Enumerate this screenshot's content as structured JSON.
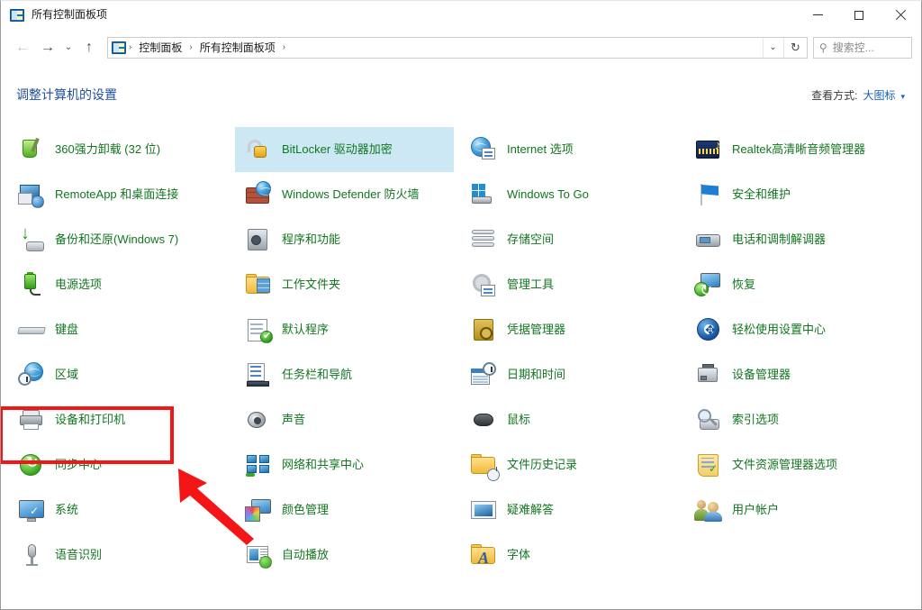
{
  "window": {
    "title": "所有控制面板项",
    "title_icon": "control-panel-icon",
    "minimize_label": "—",
    "maximize_label": "□",
    "close_label": "✕"
  },
  "navbar": {
    "back_label": "←",
    "forward_label": "→",
    "recent_label": "⌄",
    "up_label": "↑",
    "breadcrumb": [
      "控制面板",
      "所有控制面板项"
    ],
    "separator": "›",
    "dropdown_label": "⌄",
    "refresh_label": "↻"
  },
  "search": {
    "icon": "search-icon",
    "text": "搜索控..."
  },
  "header": {
    "heading": "调整计算机的设置",
    "viewby_label": "查看方式:",
    "viewby_value": "大图标",
    "viewby_caret": "▾"
  },
  "columns": [
    {
      "items": [
        {
          "label": "360强力卸载 (32 位)",
          "icon": "uninstaller-icon",
          "hover": false
        },
        {
          "label": "RemoteApp 和桌面连接",
          "icon": "remoteapp-icon",
          "hover": false
        },
        {
          "label": "备份和还原(Windows 7)",
          "icon": "backup-restore-icon",
          "hover": false
        },
        {
          "label": "电源选项",
          "icon": "power-options-icon",
          "hover": false
        },
        {
          "label": "键盘",
          "icon": "keyboard-icon",
          "hover": false
        },
        {
          "label": "区域",
          "icon": "region-icon",
          "hover": false
        },
        {
          "label": "设备和打印机",
          "icon": "devices-printers-icon",
          "hover": false
        },
        {
          "label": "同步中心",
          "icon": "sync-center-icon",
          "hover": false
        },
        {
          "label": "系统",
          "icon": "system-icon",
          "hover": false
        },
        {
          "label": "语音识别",
          "icon": "speech-recognition-icon",
          "hover": false
        }
      ]
    },
    {
      "items": [
        {
          "label": "BitLocker 驱动器加密",
          "icon": "bitlocker-icon",
          "hover": true
        },
        {
          "label": "Windows Defender 防火墙",
          "icon": "firewall-icon",
          "hover": false
        },
        {
          "label": "程序和功能",
          "icon": "programs-features-icon",
          "hover": false
        },
        {
          "label": "工作文件夹",
          "icon": "work-folders-icon",
          "hover": false
        },
        {
          "label": "默认程序",
          "icon": "default-programs-icon",
          "hover": false
        },
        {
          "label": "任务栏和导航",
          "icon": "taskbar-navigation-icon",
          "hover": false
        },
        {
          "label": "声音",
          "icon": "sound-icon",
          "hover": false
        },
        {
          "label": "网络和共享中心",
          "icon": "network-sharing-icon",
          "hover": false
        },
        {
          "label": "颜色管理",
          "icon": "color-management-icon",
          "hover": false
        },
        {
          "label": "自动播放",
          "icon": "autoplay-icon",
          "hover": false
        }
      ]
    },
    {
      "items": [
        {
          "label": "Internet 选项",
          "icon": "internet-options-icon",
          "hover": false
        },
        {
          "label": "Windows To Go",
          "icon": "windows-to-go-icon",
          "hover": false
        },
        {
          "label": "存储空间",
          "icon": "storage-spaces-icon",
          "hover": false
        },
        {
          "label": "管理工具",
          "icon": "administrative-tools-icon",
          "hover": false
        },
        {
          "label": "凭据管理器",
          "icon": "credential-manager-icon",
          "hover": false
        },
        {
          "label": "日期和时间",
          "icon": "date-time-icon",
          "hover": false
        },
        {
          "label": "鼠标",
          "icon": "mouse-icon",
          "hover": false
        },
        {
          "label": "文件历史记录",
          "icon": "file-history-icon",
          "hover": false
        },
        {
          "label": "疑难解答",
          "icon": "troubleshooting-icon",
          "hover": false
        },
        {
          "label": "字体",
          "icon": "fonts-icon",
          "hover": false
        }
      ]
    },
    {
      "items": [
        {
          "label": "Realtek高清晰音频管理器",
          "icon": "realtek-audio-icon",
          "hover": false
        },
        {
          "label": "安全和维护",
          "icon": "security-maintenance-icon",
          "hover": false
        },
        {
          "label": "电话和调制解调器",
          "icon": "phone-modem-icon",
          "hover": false
        },
        {
          "label": "恢复",
          "icon": "recovery-icon",
          "hover": false
        },
        {
          "label": "轻松使用设置中心",
          "icon": "ease-of-access-icon",
          "hover": false
        },
        {
          "label": "设备管理器",
          "icon": "device-manager-icon",
          "hover": false
        },
        {
          "label": "索引选项",
          "icon": "indexing-options-icon",
          "hover": false
        },
        {
          "label": "文件资源管理器选项",
          "icon": "file-explorer-options-icon",
          "hover": false
        },
        {
          "label": "用户帐户",
          "icon": "user-accounts-icon",
          "hover": false
        }
      ]
    }
  ],
  "annotations": {
    "highlight": {
      "target": "设备和打印机",
      "color": "#f41616"
    },
    "arrow": {
      "points_to": "设备和打印机",
      "color": "#f41616"
    }
  },
  "colors": {
    "item_text": "#12761f",
    "heading": "#1f4e9c",
    "link": "#1862b5",
    "hover_bg": "#cce8f5",
    "annotation": "#f41616"
  }
}
